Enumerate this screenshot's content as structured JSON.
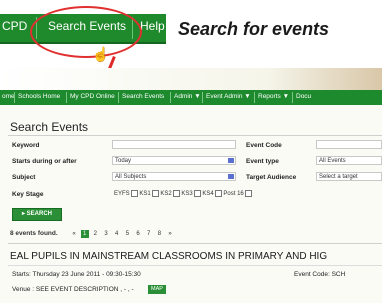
{
  "top_nav": {
    "left_fragment": "CPD",
    "search_events": "Search Events",
    "right_fragment": "Help"
  },
  "callout": {
    "title": "Search for events"
  },
  "sub_nav": [
    "ome",
    "Schools Home",
    "My CPD Online",
    "Search Events",
    "Admin ▼",
    "Event Admin ▼",
    "Reports ▼",
    "Docu"
  ],
  "page": {
    "title": "Search Events"
  },
  "form": {
    "keyword_label": "Keyword",
    "keyword_value": "",
    "starts_label": "Starts during or after",
    "starts_value": "Today",
    "subject_label": "Subject",
    "subject_value": "All Subjects",
    "key_stage_label": "Key Stage",
    "event_code_label": "Event Code",
    "event_code_value": "",
    "event_type_label": "Event type",
    "event_type_value": "All Events",
    "target_label": "Target Audience",
    "target_value": "Select a target",
    "key_stages": [
      "EYFS",
      "KS1",
      "KS2",
      "KS3",
      "KS4",
      "Post 16"
    ],
    "search_button": "SEARCH"
  },
  "results": {
    "found_text": "8 events found.",
    "pages": [
      "«",
      "1",
      "2",
      "3",
      "4",
      "5",
      "6",
      "7",
      "8",
      "»"
    ],
    "current_page": "1"
  },
  "event": {
    "title": "EAL PUPILS IN MAINSTREAM CLASSROOMS IN PRIMARY AND HIG",
    "starts": "Starts: Thursday 23 June 2011 - 09:30-15:30",
    "code": "Event Code: SCH",
    "venue": "Venue : SEE EVENT DESCRIPTION , - , -",
    "map_button": "MAP"
  },
  "colors": {
    "nav_green": "#1f8a2c",
    "callout_red": "#e03030"
  }
}
